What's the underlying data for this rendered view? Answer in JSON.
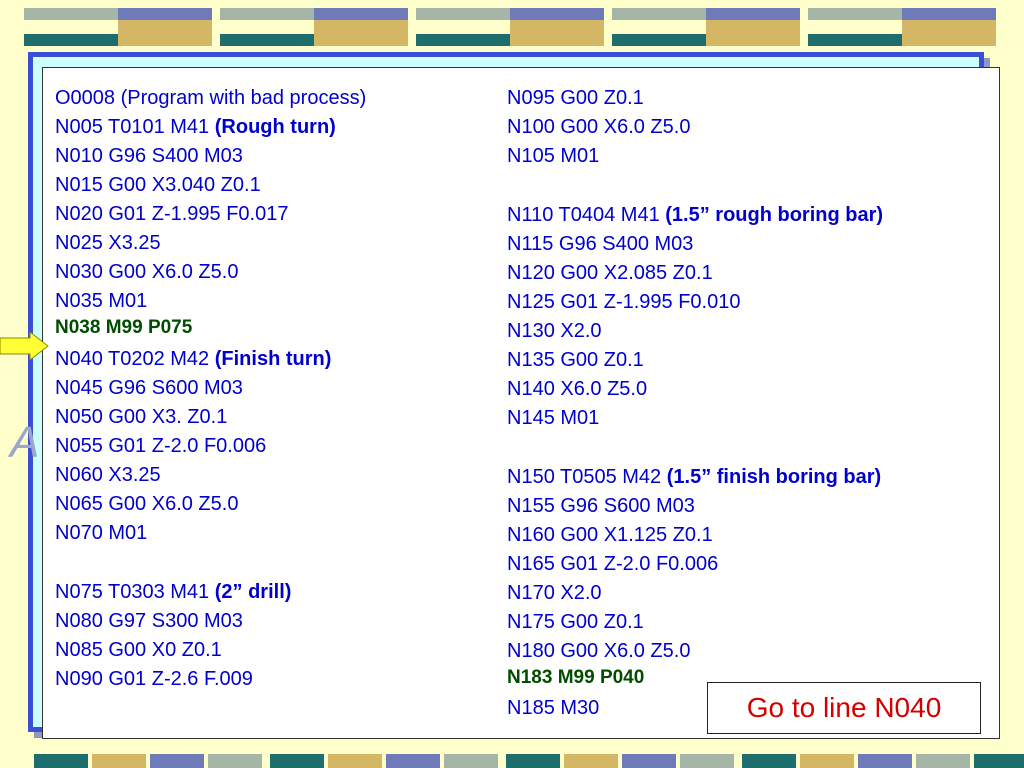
{
  "slide": {
    "ghost_text": "A"
  },
  "colors": {
    "code_text": "#0000cc",
    "highlight_text": "#004d00",
    "goto_text": "#d40000",
    "frame_border": "#3a4fd6",
    "arrow_fill": "#ffff33"
  },
  "program": {
    "left_column": [
      {
        "text": "O0008 (Program with bad process)",
        "bold": ""
      },
      {
        "text": "N005 T0101 M41 ",
        "bold": "(Rough turn)"
      },
      {
        "text": "N010 G96 S400 M03",
        "bold": ""
      },
      {
        "text": "N015 G00 X3.040 Z0.1",
        "bold": ""
      },
      {
        "text": "N020 G01 Z-1.995 F0.017",
        "bold": ""
      },
      {
        "text": "N025 X3.25",
        "bold": ""
      },
      {
        "text": "N030 G00 X6.0 Z5.0",
        "bold": ""
      },
      {
        "text": "N035 M01",
        "bold": ""
      },
      {
        "text": "N038 M99 P075",
        "bold": "",
        "highlight": true
      },
      {
        "text": "N040 T0202 M42 ",
        "bold": "(Finish turn)"
      },
      {
        "text": "N045 G96 S600 M03",
        "bold": ""
      },
      {
        "text": "N050 G00 X3. Z0.1",
        "bold": ""
      },
      {
        "text": "N055 G01 Z-2.0 F0.006",
        "bold": ""
      },
      {
        "text": "N060 X3.25",
        "bold": ""
      },
      {
        "text": "N065 G00 X6.0 Z5.0",
        "bold": ""
      },
      {
        "text": "N070 M01",
        "bold": ""
      },
      {
        "text": "N075 T0303 M41 ",
        "bold": "(2” drill)"
      },
      {
        "text": "N080 G97 S300 M03",
        "bold": ""
      },
      {
        "text": "N085 G00 X0 Z0.1",
        "bold": ""
      },
      {
        "text": "N090 G01 Z-2.6 F.009",
        "bold": ""
      }
    ],
    "right_column": [
      {
        "text": "N095 G00 Z0.1",
        "bold": ""
      },
      {
        "text": "N100 G00 X6.0 Z5.0",
        "bold": ""
      },
      {
        "text": "N105 M01",
        "bold": ""
      },
      {
        "text": "N110 T0404 M41 ",
        "bold": "(1.5” rough boring bar)"
      },
      {
        "text": "N115 G96 S400 M03",
        "bold": ""
      },
      {
        "text": "N120 G00 X2.085 Z0.1",
        "bold": ""
      },
      {
        "text": "N125 G01 Z-1.995 F0.010",
        "bold": ""
      },
      {
        "text": "N130 X2.0",
        "bold": ""
      },
      {
        "text": "N135 G00 Z0.1",
        "bold": ""
      },
      {
        "text": "N140 X6.0 Z5.0",
        "bold": ""
      },
      {
        "text": "N145 M01",
        "bold": ""
      },
      {
        "text": "N150 T0505 M42 ",
        "bold": "(1.5” finish boring bar)"
      },
      {
        "text": "N155 G96 S600 M03",
        "bold": ""
      },
      {
        "text": "N160 G00 X1.125 Z0.1",
        "bold": ""
      },
      {
        "text": "N165 G01 Z-2.0 F0.006",
        "bold": ""
      },
      {
        "text": "N170 X2.0",
        "bold": ""
      },
      {
        "text": "N175 G00 Z0.1",
        "bold": ""
      },
      {
        "text": "N180 G00 X6.0 Z5.0",
        "bold": ""
      },
      {
        "text": "N183 M99 P040",
        "bold": "",
        "highlight": true
      },
      {
        "text": "N185 M30",
        "bold": ""
      }
    ]
  },
  "goto_label": "Go to line N040"
}
